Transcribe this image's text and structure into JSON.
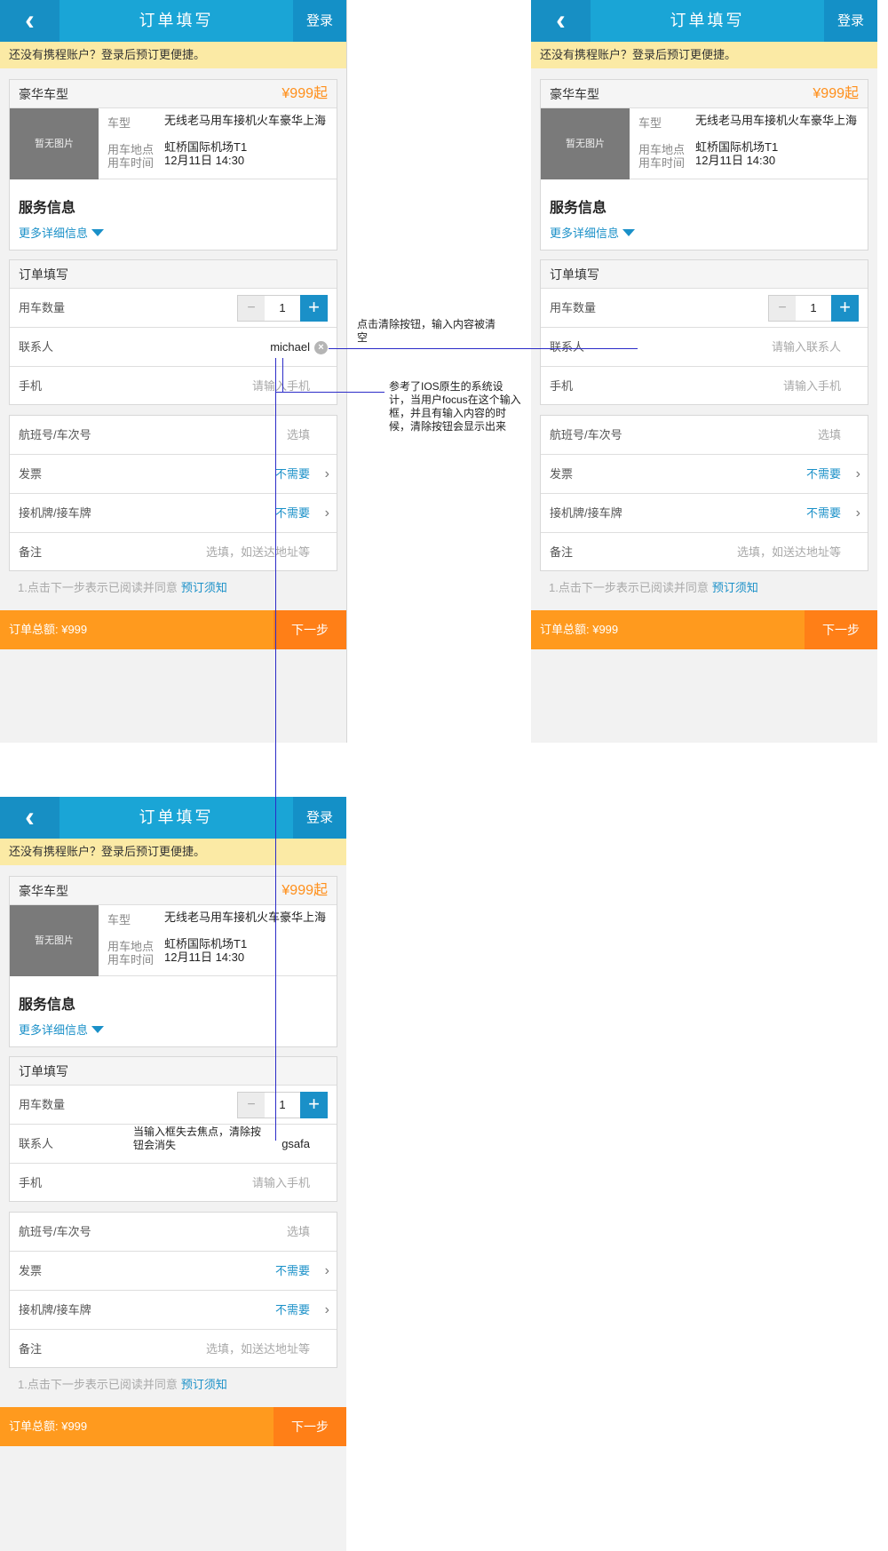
{
  "header": {
    "back_icon": "chevron-left-icon",
    "title": "订单填写",
    "login": "登录"
  },
  "notice": "还没有携程账户？登录后预订更便捷。",
  "product": {
    "head": "豪华车型",
    "price": "¥999起",
    "no_image": "暂无图片",
    "car_type_label": "车型",
    "car_type_value": "无线老马用车接机火车豪华上海",
    "place_label": "用车地点",
    "place_value": "虹桥国际机场T1",
    "time_label": "用车时间",
    "time_value": "12月11日 14:30",
    "service_title": "服务信息",
    "more_link": "更多详细信息"
  },
  "form": {
    "head": "订单填写",
    "quantity_label": "用车数量",
    "quantity_value": "1",
    "minus": "−",
    "plus": "+",
    "contact_label": "联系人",
    "contact_placeholder": "请输入联系人",
    "phone_label": "手机",
    "phone_placeholder": "请输入手机",
    "flight_label": "航班号/车次号",
    "flight_placeholder": "选填",
    "invoice_label": "发票",
    "invoice_value": "不需要",
    "pickup_label": "接机牌/接车牌",
    "pickup_value": "不需要",
    "remark_label": "备注",
    "remark_placeholder": "选填，如送达地址等",
    "chevron": "›"
  },
  "agreement": {
    "text": "1.点击下一步表示已阅读并同意",
    "link": "预订须知"
  },
  "footer": {
    "total": "订单总额: ¥999",
    "next": "下一步"
  },
  "screens": {
    "s1_contact_value": "michael",
    "s3_contact_value": "gsafa"
  },
  "annotations": {
    "clear_tap": "点击清除按钮，输入内容被清空",
    "ios_design": "参考了IOS原生的系统设计，当用户focus在这个输入框，并且有输入内容的时候，清除按钮会显示出来",
    "blur": "当输入框失去焦点，清除按钮会消失"
  },
  "colors": {
    "header": "#1aa5d6",
    "accent": "#ff9a1e",
    "link": "#1a90c8",
    "notice_bg": "#fbeaa5"
  }
}
